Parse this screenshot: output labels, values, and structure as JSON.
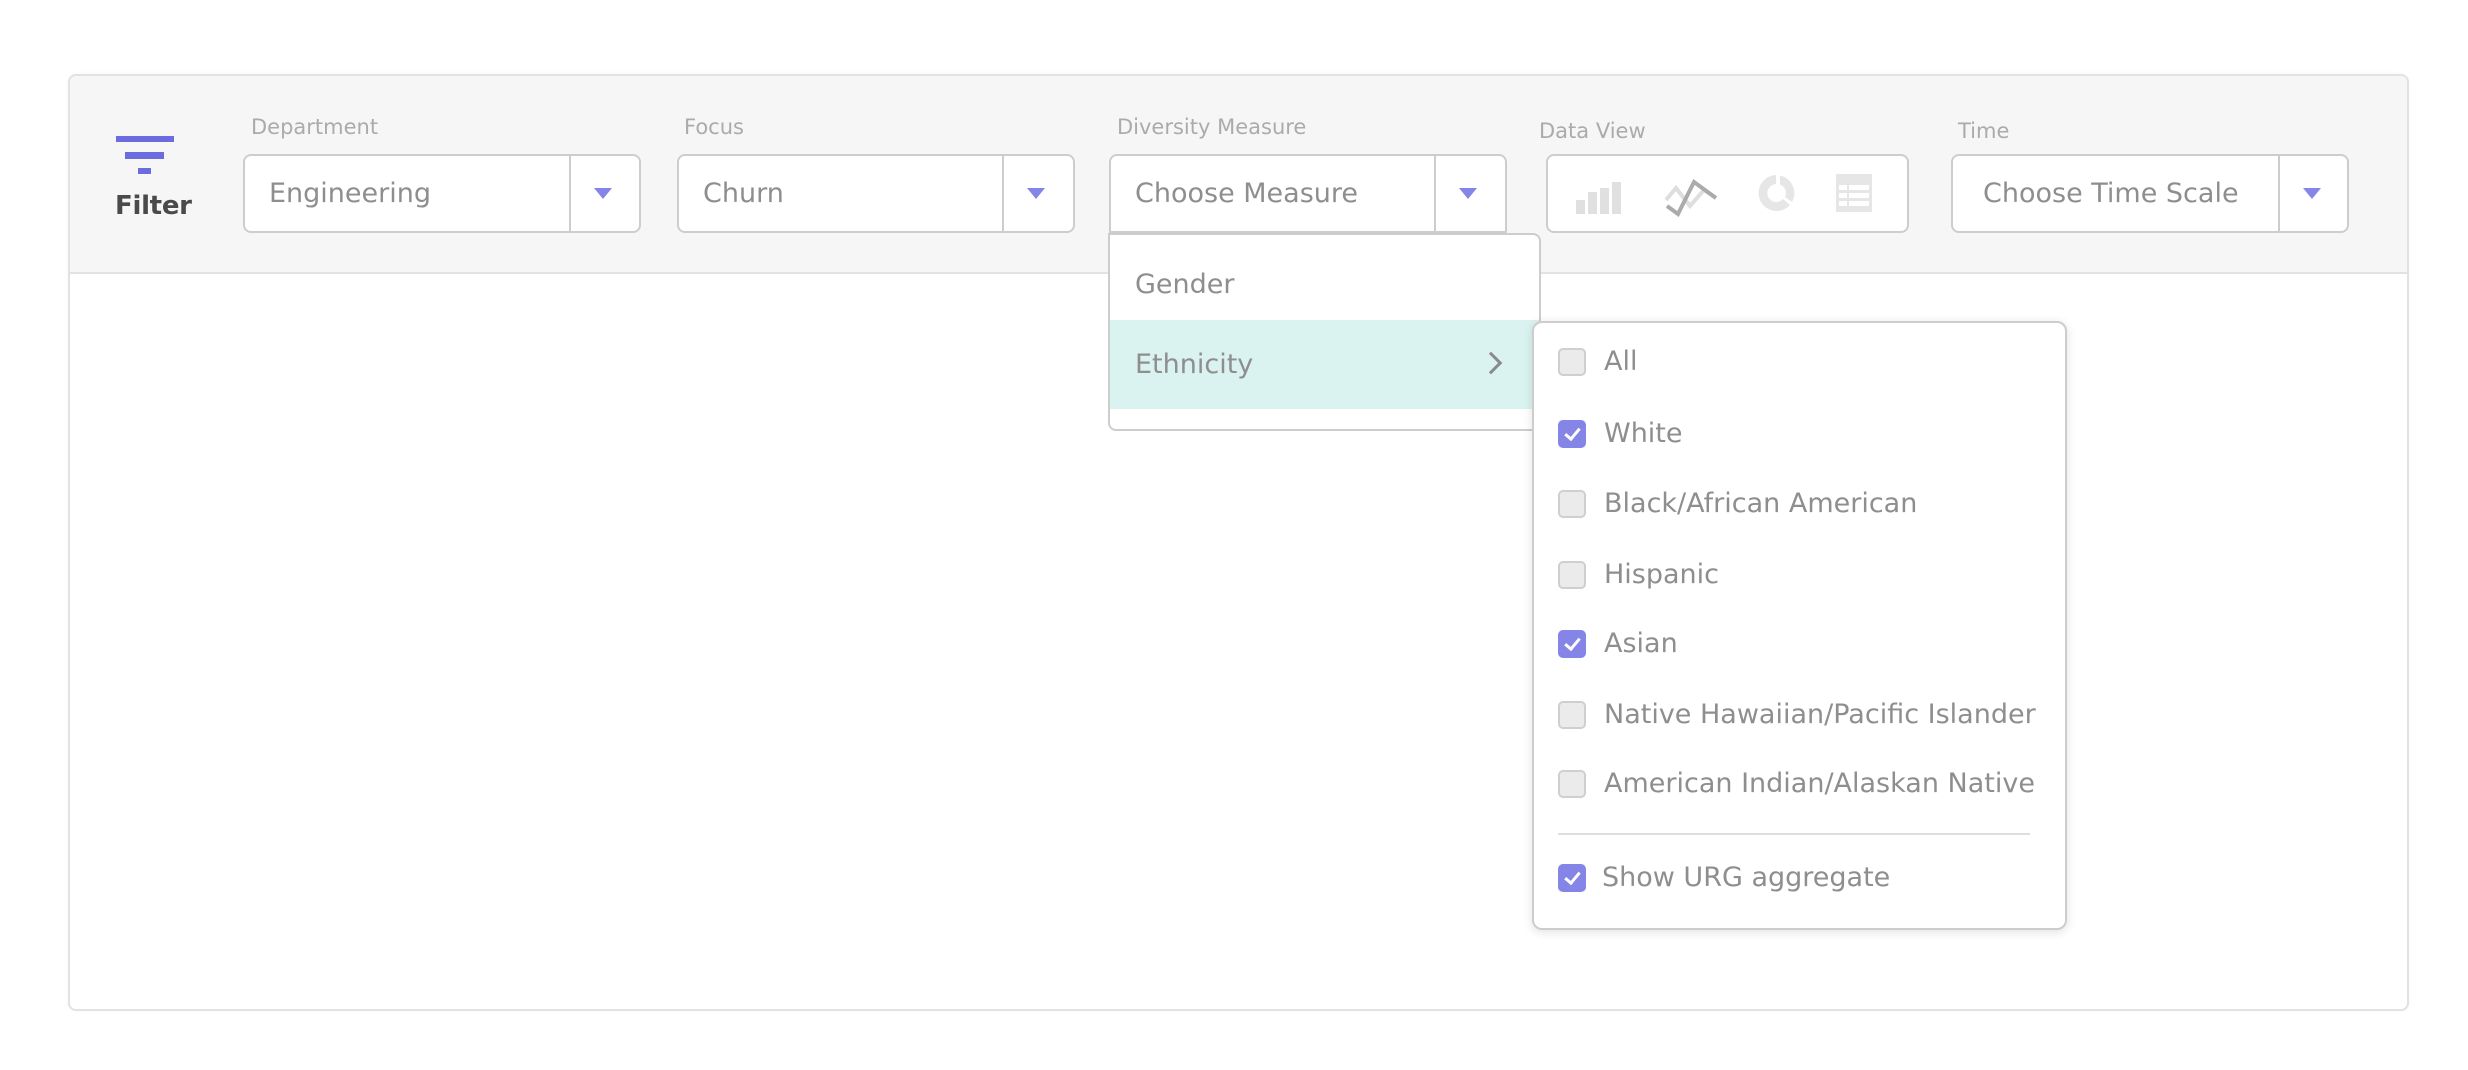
{
  "filter": {
    "icon": "filter-funnel-icon",
    "label": "Filter"
  },
  "fields": {
    "department": {
      "label": "Department",
      "value": "Engineering",
      "icon": "caret-down-icon"
    },
    "focus": {
      "label": "Focus",
      "value": "Churn",
      "icon": "caret-down-icon"
    },
    "diversity_measure": {
      "label": "Diversity Measure",
      "value": "Choose Measure",
      "icon": "caret-down-icon",
      "open": true
    },
    "data_view": {
      "label": "Data View",
      "options": [
        {
          "name": "bar-chart",
          "icon": "bar-chart-icon"
        },
        {
          "name": "line-chart",
          "icon": "line-chart-icon"
        },
        {
          "name": "donut-chart",
          "icon": "donut-chart-icon"
        },
        {
          "name": "table",
          "icon": "table-icon"
        }
      ]
    },
    "time": {
      "label": "Time",
      "value": "Choose Time Scale",
      "icon": "caret-down-icon"
    }
  },
  "measure_menu": {
    "items": [
      {
        "label": "Gender",
        "active": false
      },
      {
        "label": "Ethnicity",
        "active": true,
        "icon": "chevron-right-icon"
      }
    ]
  },
  "ethnicity_submenu": {
    "options": [
      {
        "label": "All",
        "checked": false
      },
      {
        "label": "White",
        "checked": true
      },
      {
        "label": "Black/African American",
        "checked": false
      },
      {
        "label": "Hispanic",
        "checked": false
      },
      {
        "label": "Asian",
        "checked": true
      },
      {
        "label": "Native Hawaiian/Pacific Islander",
        "checked": false
      },
      {
        "label": "American Indian/Alaskan Native",
        "checked": false
      }
    ],
    "aggregate": {
      "label": "Show URG aggregate",
      "checked": true
    }
  },
  "colors": {
    "accent": "#8585e8",
    "filter_icon": "#6c6ce0",
    "active_row": "#daf3f0",
    "header_bg": "#f6f6f6",
    "border": "#cdcdcd"
  }
}
